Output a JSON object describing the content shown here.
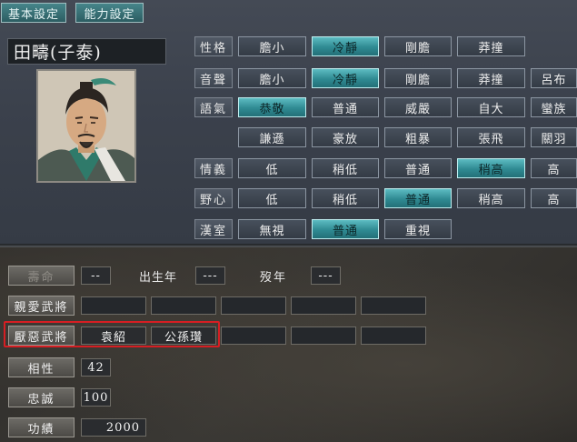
{
  "tabs": [
    {
      "label": "基本設定"
    },
    {
      "label": "能力設定"
    }
  ],
  "character": {
    "name": "田疇(子泰)"
  },
  "traits": [
    {
      "label": "性格",
      "options": [
        "膽小",
        "冷靜",
        "剛膽",
        "莽撞"
      ],
      "selected": "冷靜"
    },
    {
      "label": "音聲",
      "options": [
        "膽小",
        "冷靜",
        "剛膽",
        "莽撞",
        "呂布"
      ],
      "selected": "冷靜"
    },
    {
      "label": "語氣",
      "options": [
        "恭敬",
        "普通",
        "威嚴",
        "自大",
        "蠻族"
      ],
      "selected": "恭敬"
    },
    {
      "label": "",
      "options": [
        "謙遜",
        "豪放",
        "粗暴",
        "張飛",
        "關羽"
      ],
      "selected": ""
    },
    {
      "label": "情義",
      "options": [
        "低",
        "稍低",
        "普通",
        "稍高",
        "高"
      ],
      "selected": "稍高"
    },
    {
      "label": "野心",
      "options": [
        "低",
        "稍低",
        "普通",
        "稍高",
        "高"
      ],
      "selected": "普通"
    },
    {
      "label": "漢室",
      "options": [
        "無視",
        "普通",
        "重視"
      ],
      "selected": "普通"
    }
  ],
  "stats": {
    "lifespan_label": "壽命",
    "lifespan_value": "--",
    "birth_label": "出生年",
    "birth_value": "---",
    "death_label": "歿年",
    "death_value": "---",
    "favored_label": "親愛武將",
    "favored": [
      "",
      "",
      "",
      "",
      ""
    ],
    "disliked_label": "厭惡武將",
    "disliked": [
      "袁紹",
      "公孫瓚",
      "",
      "",
      ""
    ],
    "compat_label": "相性",
    "compat_value": "42",
    "loyalty_label": "忠誠",
    "loyalty_value": "100",
    "merit_label": "功績",
    "merit_value": "2000"
  },
  "colors": {
    "selected_option": "#2f8a92",
    "highlight_border": "#d61e23"
  }
}
